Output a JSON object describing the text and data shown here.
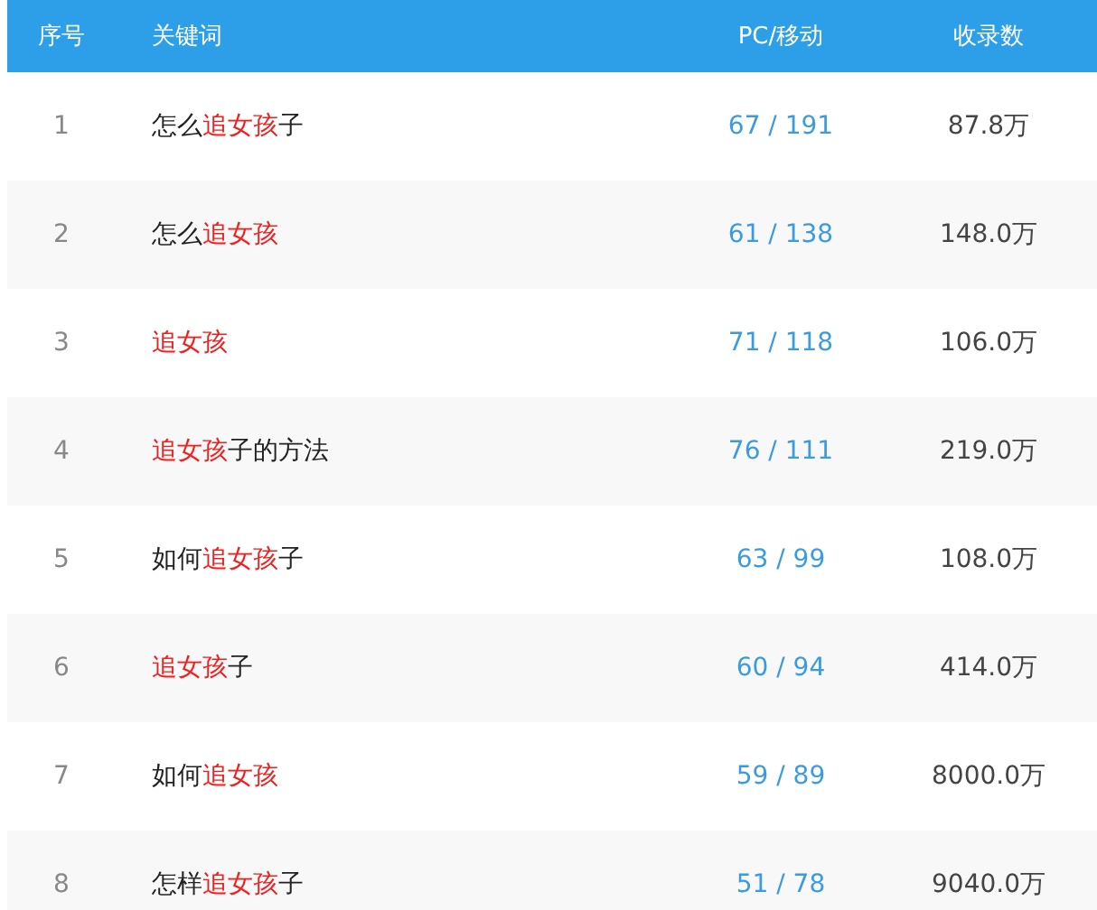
{
  "table": {
    "columns": [
      "序号",
      "关键词",
      "PC/移动",
      "收录数"
    ],
    "rows": [
      {
        "index": "1",
        "keyword": [
          {
            "text": "怎么",
            "highlight": false
          },
          {
            "text": "追女孩",
            "highlight": true
          },
          {
            "text": "子",
            "highlight": false
          }
        ],
        "pc_mobile": "67 / 191",
        "count": "87.8万"
      },
      {
        "index": "2",
        "keyword": [
          {
            "text": "怎么",
            "highlight": false
          },
          {
            "text": "追女孩",
            "highlight": true
          }
        ],
        "pc_mobile": "61 / 138",
        "count": "148.0万"
      },
      {
        "index": "3",
        "keyword": [
          {
            "text": "追女孩",
            "highlight": true
          }
        ],
        "pc_mobile": "71 / 118",
        "count": "106.0万"
      },
      {
        "index": "4",
        "keyword": [
          {
            "text": "追女孩",
            "highlight": true
          },
          {
            "text": "子的方法",
            "highlight": false
          }
        ],
        "pc_mobile": "76 / 111",
        "count": "219.0万"
      },
      {
        "index": "5",
        "keyword": [
          {
            "text": "如何",
            "highlight": false
          },
          {
            "text": "追女孩",
            "highlight": true
          },
          {
            "text": "子",
            "highlight": false
          }
        ],
        "pc_mobile": "63 / 99",
        "count": "108.0万"
      },
      {
        "index": "6",
        "keyword": [
          {
            "text": "追女孩",
            "highlight": true
          },
          {
            "text": "子",
            "highlight": false
          }
        ],
        "pc_mobile": "60 / 94",
        "count": "414.0万"
      },
      {
        "index": "7",
        "keyword": [
          {
            "text": "如何",
            "highlight": false
          },
          {
            "text": "追女孩",
            "highlight": true
          }
        ],
        "pc_mobile": "59 / 89",
        "count": "8000.0万"
      },
      {
        "index": "8",
        "keyword": [
          {
            "text": "怎样",
            "highlight": false
          },
          {
            "text": "追女孩",
            "highlight": true
          },
          {
            "text": "子",
            "highlight": false
          }
        ],
        "pc_mobile": "51 / 78",
        "count": "9040.0万"
      }
    ]
  }
}
